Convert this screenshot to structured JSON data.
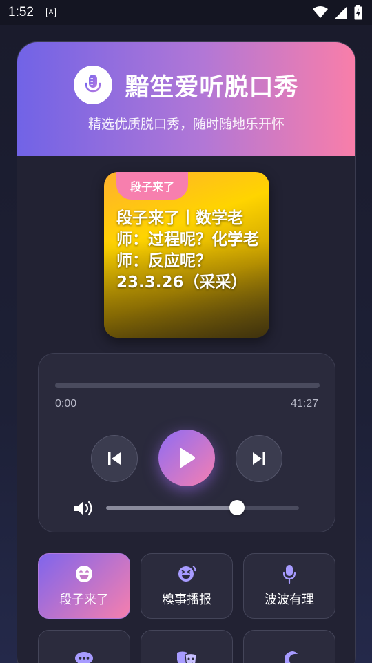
{
  "status_bar": {
    "time": "1:52",
    "icons": [
      "keyboard-a-icon",
      "wifi-icon",
      "signal-icon",
      "battery-charging-icon"
    ]
  },
  "header": {
    "title": "黯笙爱听脱口秀",
    "subtitle": "精选优质脱口秀，随时随地乐开怀",
    "icon": "microphone-icon"
  },
  "now_playing": {
    "category_badge": "段子来了",
    "title": "段子来了丨数学老师：过程呢？化学老师：反应呢？23.3.26（采采）"
  },
  "player": {
    "current_time": "0:00",
    "total_time": "41:27",
    "progress": 0,
    "volume": 0.68,
    "controls": [
      "skip-previous-icon",
      "play-icon",
      "skip-next-icon"
    ]
  },
  "categories": [
    {
      "label": "段子来了",
      "icon": "laugh-emoji-icon",
      "active": true
    },
    {
      "label": "糗事播报",
      "icon": "grin-squint-icon",
      "active": false
    },
    {
      "label": "波波有理",
      "icon": "microphone-icon",
      "active": false
    },
    {
      "label": "",
      "icon": "chat-bubble-icon",
      "active": false
    },
    {
      "label": "",
      "icon": "theater-masks-icon",
      "active": false
    },
    {
      "label": "",
      "icon": "moon-icon",
      "active": false
    }
  ],
  "colors": {
    "accent_start": "#7163e6",
    "accent_end": "#f97ea9",
    "icon_purple": "#a79bff"
  }
}
